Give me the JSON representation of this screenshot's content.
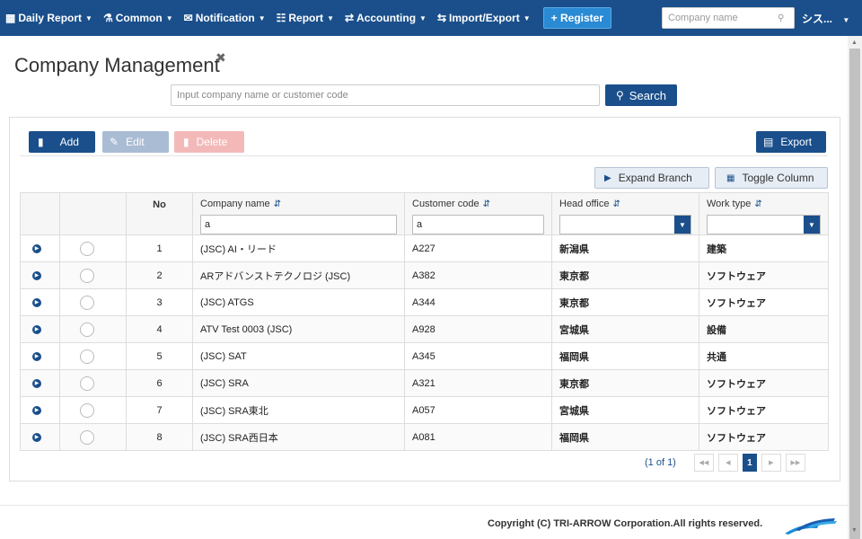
{
  "nav": {
    "items": [
      {
        "label": "Daily Report",
        "icon": "calendar-icon",
        "glyph": "▦"
      },
      {
        "label": "Common",
        "icon": "users-icon",
        "glyph": "⚗"
      },
      {
        "label": "Notification",
        "icon": "envelope-icon",
        "glyph": "✉"
      },
      {
        "label": "Report",
        "icon": "bar-chart-icon",
        "glyph": "☷"
      },
      {
        "label": "Accounting",
        "icon": "exchange-icon",
        "glyph": "⇄"
      },
      {
        "label": "Import/Export",
        "icon": "transfer-icon",
        "glyph": "⇆"
      }
    ],
    "register_label": "Register",
    "company_search_placeholder": "Company name",
    "user_label": "シス..."
  },
  "page": {
    "title": "Company Management"
  },
  "search": {
    "placeholder": "Input company name or customer code",
    "button_label": "Search"
  },
  "toolbar": {
    "add_label": "Add",
    "edit_label": "Edit",
    "delete_label": "Delete",
    "export_label": "Export",
    "expand_label": "Expand Branch",
    "toggle_label": "Toggle Column"
  },
  "table": {
    "headers": {
      "no": "No",
      "company_name": "Company name",
      "customer_code": "Customer code",
      "head_office": "Head office",
      "work_type": "Work type"
    },
    "filters": {
      "company_name": "a",
      "customer_code": "a",
      "head_office": "",
      "work_type": ""
    },
    "rows": [
      {
        "no": "1",
        "company": "(JSC) AI・リード",
        "code": "A227",
        "office": "新潟県",
        "work": "建築"
      },
      {
        "no": "2",
        "company": "ARアドバンストテクノロジ (JSC)",
        "code": "A382",
        "office": "東京都",
        "work": "ソフトウェア"
      },
      {
        "no": "3",
        "company": "(JSC) ATGS",
        "code": "A344",
        "office": "東京都",
        "work": "ソフトウェア"
      },
      {
        "no": "4",
        "company": "ATV Test 0003 (JSC)",
        "code": "A928",
        "office": "宮城県",
        "work": "設備"
      },
      {
        "no": "5",
        "company": "(JSC) SAT",
        "code": "A345",
        "office": "福岡県",
        "work": "共通"
      },
      {
        "no": "6",
        "company": "(JSC) SRA",
        "code": "A321",
        "office": "東京都",
        "work": "ソフトウェア"
      },
      {
        "no": "7",
        "company": "(JSC) SRA東北",
        "code": "A057",
        "office": "宮城県",
        "work": "ソフトウェア"
      },
      {
        "no": "8",
        "company": "(JSC) SRA西日本",
        "code": "A081",
        "office": "福岡県",
        "work": "ソフトウェア"
      }
    ]
  },
  "pager": {
    "info": "(1 of 1)",
    "current_page": "1"
  },
  "footer": {
    "copyright": "Copyright (C) TRI-ARROW Corporation.All rights reserved."
  },
  "colors": {
    "primary": "#1a4f8b",
    "disabled_edit": "#a9bcd3",
    "disabled_delete": "#f3b9b9"
  }
}
